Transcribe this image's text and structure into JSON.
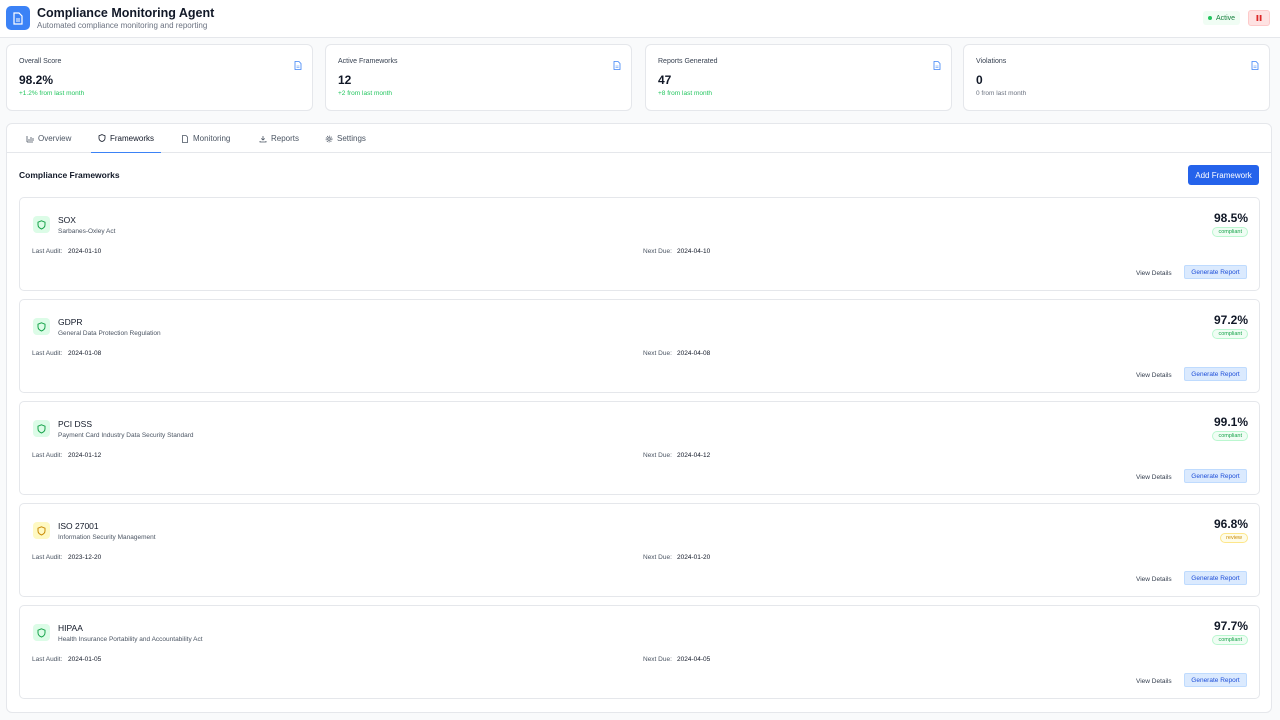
{
  "header": {
    "title": "Compliance Monitoring Agent",
    "subtitle": "Automated compliance monitoring and reporting",
    "status": "Active",
    "logo_icon": "document-icon",
    "stop_icon": "pause-icon"
  },
  "stats": [
    {
      "label": "Overall Score",
      "value": "98.2%",
      "delta": "+1.2% from last month",
      "delta_color": "#22c55e",
      "icon": "document-icon"
    },
    {
      "label": "Active Frameworks",
      "value": "12",
      "delta": "+2 from last month",
      "delta_color": "#22c55e",
      "icon": "document-icon"
    },
    {
      "label": "Reports Generated",
      "value": "47",
      "delta": "+8 from last month",
      "delta_color": "#22c55e",
      "icon": "document-icon"
    },
    {
      "label": "Violations",
      "value": "0",
      "delta": "0 from last month",
      "delta_color": "#6b7280",
      "icon": "document-icon"
    }
  ],
  "tabs": [
    {
      "label": "Overview",
      "icon": "bar-chart-icon"
    },
    {
      "label": "Frameworks",
      "icon": "shield-icon",
      "active": true
    },
    {
      "label": "Monitoring",
      "icon": "document-icon"
    },
    {
      "label": "Reports",
      "icon": "download-icon"
    },
    {
      "label": "Settings",
      "icon": "gear-icon"
    }
  ],
  "main": {
    "section_title": "Compliance Frameworks",
    "add_button": "Add Framework"
  },
  "labels": {
    "last_audit": "Last Audit:",
    "next_due": "Next Due:",
    "view_details": "View Details",
    "generate_report": "Generate Report"
  },
  "frameworks": [
    {
      "name": "SOX",
      "description": "Sarbanes-Oxley Act",
      "last_audit": "2024-01-10",
      "next_due": "2024-04-10",
      "score": "98.5%",
      "status": "compliant"
    },
    {
      "name": "GDPR",
      "description": "General Data Protection Regulation",
      "last_audit": "2024-01-08",
      "next_due": "2024-04-08",
      "score": "97.2%",
      "status": "compliant"
    },
    {
      "name": "PCI DSS",
      "description": "Payment Card Industry Data Security Standard",
      "last_audit": "2024-01-12",
      "next_due": "2024-04-12",
      "score": "99.1%",
      "status": "compliant"
    },
    {
      "name": "ISO 27001",
      "description": "Information Security Management",
      "last_audit": "2023-12-20",
      "next_due": "2024-01-20",
      "score": "96.8%",
      "status": "review"
    },
    {
      "name": "HIPAA",
      "description": "Health Insurance Portability and Accountability Act",
      "last_audit": "2024-01-05",
      "next_due": "2024-04-05",
      "score": "97.7%",
      "status": "compliant"
    }
  ],
  "colors": {
    "accent": "#2563eb",
    "compliant": "#16a34a",
    "review": "#ca8a04"
  }
}
